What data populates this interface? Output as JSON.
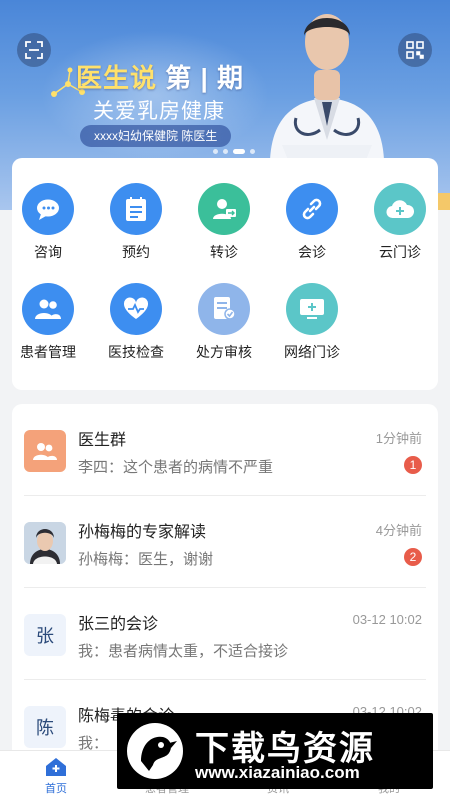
{
  "banner": {
    "title_prefix": "医生说",
    "title_issue": " 第 | 期",
    "subtitle": "关爱乳房健康",
    "tag": "xxxx妇幼保健院  陈医生",
    "scan_icon": "scan-icon",
    "qr_icon": "qr-code-icon",
    "accent_color": "#ffe16b"
  },
  "services": [
    {
      "label": "咨询",
      "icon": "chat-bubble-icon",
      "color": "#3d8ef0"
    },
    {
      "label": "预约",
      "icon": "calendar-list-icon",
      "color": "#3d8ef0"
    },
    {
      "label": "转诊",
      "icon": "person-transfer-icon",
      "color": "#3bbf9a"
    },
    {
      "label": "会诊",
      "icon": "link-icon",
      "color": "#3d8ef0"
    },
    {
      "label": "云门诊",
      "icon": "cloud-plus-icon",
      "color": "#5bc6c8"
    },
    {
      "label": "患者管理",
      "icon": "people-icon",
      "color": "#3d8ef0"
    },
    {
      "label": "医技检查",
      "icon": "heart-pulse-icon",
      "color": "#3d8ef0"
    },
    {
      "label": "处方审核",
      "icon": "prescription-icon",
      "color": "#8fb5ea"
    },
    {
      "label": "网络门诊",
      "icon": "monitor-plus-icon",
      "color": "#5bc6c8"
    }
  ],
  "messages": [
    {
      "name": "医生群",
      "preview": "李四：这个患者的病情不严重",
      "time": "1分钟前",
      "badge": "1",
      "avatar_type": "group",
      "avatar_color": "#f4a27a"
    },
    {
      "name": "孙梅梅的专家解读",
      "preview": "孙梅梅：医生，谢谢",
      "time": "4分钟前",
      "badge": "2",
      "avatar_type": "photo"
    },
    {
      "name": "张三的会诊",
      "preview": "我：患者病情太重，不适合接诊",
      "time": "03-12 10:02",
      "badge": "",
      "avatar_type": "letter",
      "avatar_letter": "张"
    },
    {
      "name": "陈梅毒的会诊",
      "preview": "我：",
      "time": "03-12 10:02",
      "badge": "",
      "avatar_type": "letter",
      "avatar_letter": "陈"
    }
  ],
  "tabs": [
    {
      "label": "首页",
      "icon": "home-icon",
      "active": true
    },
    {
      "label": "患者管理",
      "icon": "patients-icon",
      "active": false
    },
    {
      "label": "资讯",
      "icon": "news-icon",
      "active": false
    },
    {
      "label": "我的",
      "icon": "profile-icon",
      "active": false
    }
  ],
  "watermark": {
    "title": "下载鸟资源",
    "url": "www.xiazainiao.com"
  },
  "colors": {
    "primary": "#2f6fd8",
    "badge": "#e85c4a"
  }
}
